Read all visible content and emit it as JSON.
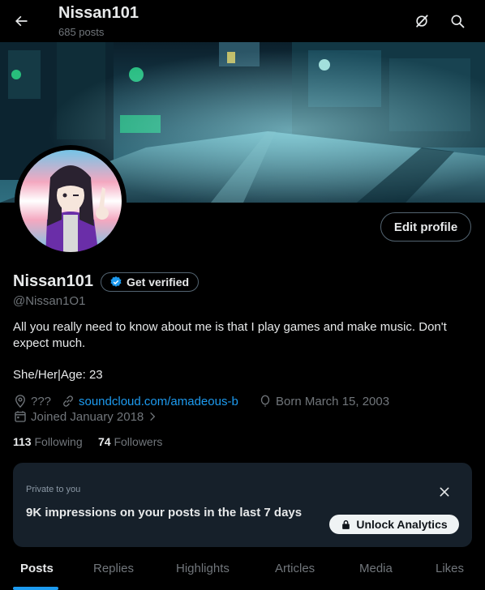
{
  "header": {
    "title": "Nissan101",
    "post_count": "685 posts"
  },
  "profile": {
    "name": "Nissan101",
    "get_verified_label": "Get verified",
    "handle": "@Nissan1O1",
    "edit_profile_label": "Edit profile",
    "bio_line1": "All you really need to know about me is that I play games and make music. Don't expect much.",
    "bio_line2": "She/Her|Age: 23",
    "location": "???",
    "website": "soundcloud.com/amadeous-b",
    "born": "Born March 15, 2003",
    "joined": "Joined January 2018"
  },
  "stats": {
    "following_count": "113",
    "following_label": "Following",
    "followers_count": "74",
    "followers_label": "Followers"
  },
  "analytics_card": {
    "caption": "Private to you",
    "headline": "9K impressions on your posts in the last 7 days",
    "unlock_label": "Unlock Analytics"
  },
  "tabs": [
    {
      "label": "Posts",
      "active": true
    },
    {
      "label": "Replies"
    },
    {
      "label": "Highlights"
    },
    {
      "label": "Articles"
    },
    {
      "label": "Media"
    },
    {
      "label": "Likes"
    }
  ],
  "colors": {
    "background": "#000000",
    "accent": "#1d9bf0",
    "muted_text": "#71767b",
    "card_background": "#16202a"
  },
  "icons": [
    "back-arrow-icon",
    "grok-icon",
    "search-icon",
    "verified-badge-icon",
    "location-icon",
    "link-icon",
    "calendar-icon",
    "chevron-right-icon",
    "close-icon",
    "lock-icon"
  ]
}
